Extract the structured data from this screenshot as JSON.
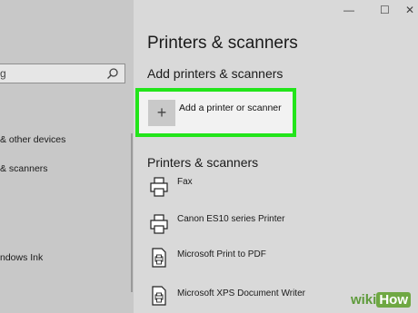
{
  "window": {
    "minimize": "—",
    "maximize": "☐",
    "close": "✕"
  },
  "sidebar": {
    "search_value": "g",
    "items": [
      {
        "label": "& other devices"
      },
      {
        "label": "& scanners"
      },
      {
        "label": "ndows Ink"
      }
    ]
  },
  "main": {
    "title": "Printers & scanners",
    "add_section_title": "Add printers & scanners",
    "add_button_label": "Add a printer or scanner",
    "add_button_icon": "plus-icon",
    "list_title": "Printers & scanners",
    "printers": [
      {
        "name": "Fax",
        "icon": "printer-icon"
      },
      {
        "name": "Canon ES10 series Printer",
        "icon": "printer-icon"
      },
      {
        "name": "Microsoft Print to PDF",
        "icon": "document-printer-icon"
      },
      {
        "name": "Microsoft XPS Document Writer",
        "icon": "document-printer-icon"
      }
    ]
  },
  "watermark": {
    "prefix": "wiki",
    "suffix": "How"
  },
  "colors": {
    "highlight": "#22e51a",
    "sidebar_bg": "#c8c8c8",
    "main_bg": "#d9d9d9"
  }
}
